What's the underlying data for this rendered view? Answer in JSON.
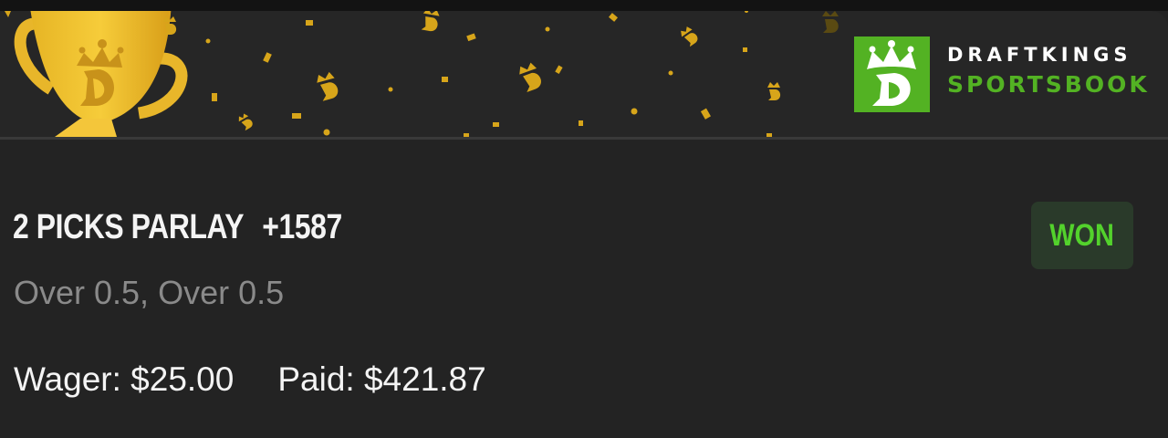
{
  "brand": {
    "line1": "DRAFTKINGS",
    "line2": "SPORTSBOOK",
    "logo_icon": "draftkings-crown-d-icon",
    "brand_green": "#53b223"
  },
  "banner": {
    "trophy_icon": "trophy-icon",
    "confetti_icon": "confetti-icon"
  },
  "bet": {
    "title": "2 PICKS PARLAY",
    "odds": "+1587",
    "selections": "Over 0.5, Over 0.5",
    "wager": "Wager: $25.00",
    "paid": "Paid: $421.87",
    "status": "WON",
    "status_color": "#53d22c"
  }
}
